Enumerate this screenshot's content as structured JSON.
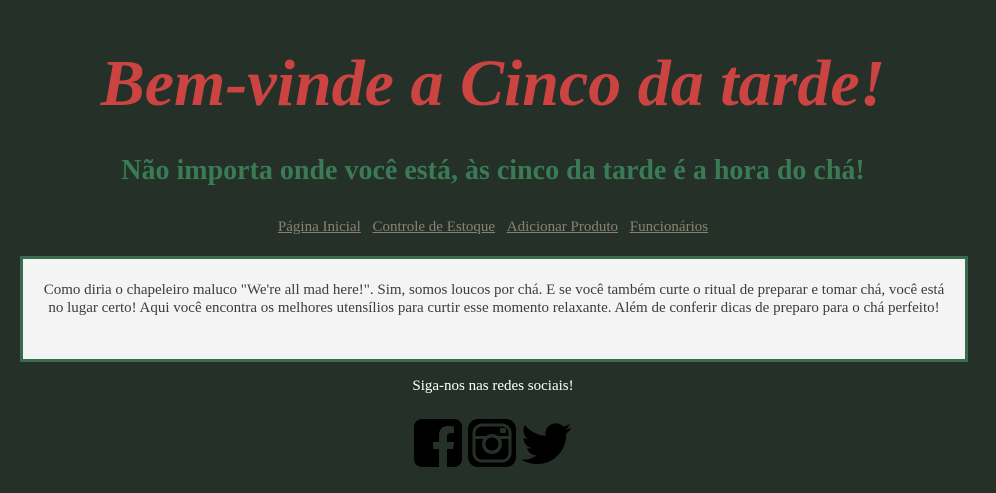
{
  "header": {
    "title": "Bem-vinde a Cinco da tarde!",
    "subtitle": "Não importa onde você está, às cinco da tarde é a hora do chá!"
  },
  "nav": {
    "items": [
      {
        "label": "Página Inicial"
      },
      {
        "label": "Controle de Estoque"
      },
      {
        "label": "Adicionar Produto"
      },
      {
        "label": "Funcionários"
      }
    ]
  },
  "about": {
    "text": "Como diria o chapeleiro maluco \"We're all mad here!\". Sim, somos loucos por chá. E se você também curte o ritual de preparar e tomar chá, você está no lugar certo! Aqui você encontra os melhores utensílios para curtir esse momento relaxante. Além de conferir dicas de preparo para o chá perfeito!"
  },
  "footer": {
    "follow_text": "Siga-nos nas redes sociais!",
    "icons": [
      "facebook-icon",
      "instagram-icon",
      "twitter-icon"
    ]
  },
  "colors": {
    "background": "#243028",
    "title": "#cc4441",
    "subtitle": "#3a7a55",
    "nav_link": "#8a8270",
    "box_border": "#3b6b4f"
  }
}
